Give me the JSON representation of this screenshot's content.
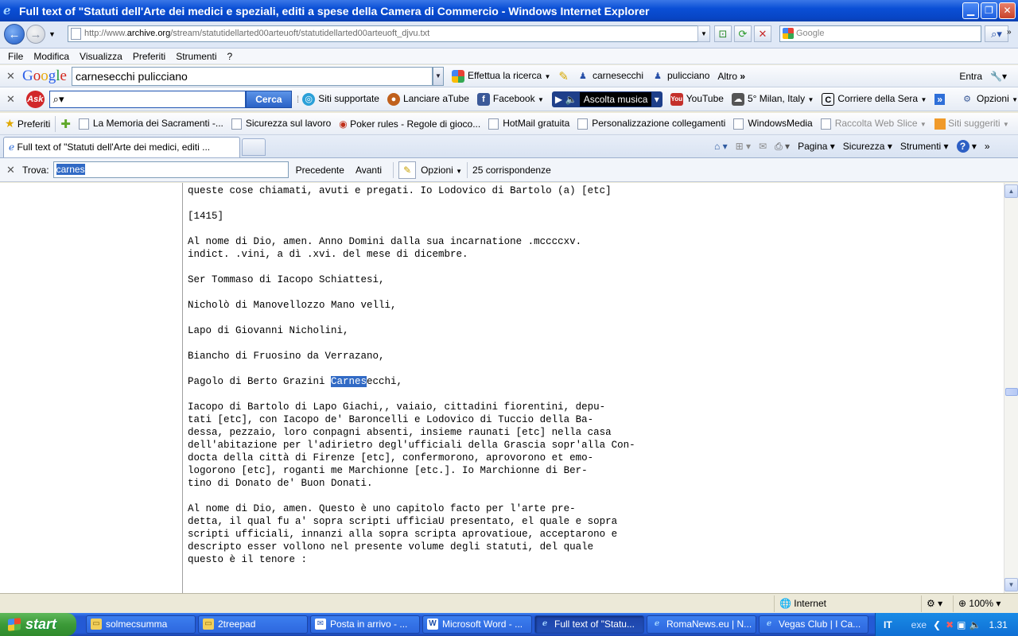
{
  "window": {
    "title": "Full text of \"Statuti dell'Arte dei medici e speziali, editi a spese della Camera di Commercio  - Windows Internet Explorer"
  },
  "address": {
    "url_prefix": "http://www.",
    "url_domain": "archive.org",
    "url_path": "/stream/statutidellarted00arteuoft/statutidellarted00arteuoft_djvu.txt",
    "search_placeholder": "Google"
  },
  "menu": [
    "File",
    "Modifica",
    "Visualizza",
    "Preferiti",
    "Strumenti",
    "?"
  ],
  "google_toolbar": {
    "logo": "Google",
    "query": "carnesecchi pulicciano",
    "search_button": "Effettua la ricerca",
    "term1": "carnesecchi",
    "term2": "pulicciano",
    "more": "Altro",
    "signin": "Entra"
  },
  "ask_toolbar": {
    "logo": "Ask",
    "search_button": "Cerca",
    "siti": "Siti supportate",
    "atube": "Lanciare aTube",
    "facebook": "Facebook",
    "ascolta": "Ascolta musica",
    "youtube": "YouTube",
    "weather": "5° Milan, Italy",
    "corriere": "Corriere della Sera",
    "opzioni": "Opzioni"
  },
  "favorites": {
    "label": "Preferiti",
    "items": [
      "La Memoria dei Sacramenti -...",
      "Sicurezza sul lavoro",
      "Poker rules - Regole di gioco...",
      "HotMail gratuita",
      "Personalizzazione collegamenti",
      "WindowsMedia",
      "Raccolta Web Slice",
      "Siti suggeriti"
    ]
  },
  "tabs": {
    "active_label": "Full text of \"Statuti dell'Arte dei medici, editi ...",
    "pagina": "Pagina",
    "sicurezza": "Sicurezza",
    "strumenti": "Strumenti"
  },
  "findbar": {
    "label": "Trova:",
    "value": "carnes",
    "prev": "Precedente",
    "next": "Avanti",
    "options": "Opzioni",
    "matches": "25 corrispondenze"
  },
  "content": {
    "line_first": "queste cose chiamati, avuti e pregati. Io Lodovico di Bartolo (a) [etc]",
    "year": "[1415]",
    "p1": "Al nome di Dio, amen. Anno Domini dalla sua incarnatione .mccccxv.\nindict. .vini, a dì .xvi. del mese di dicembre.",
    "n1": "Ser Tommaso di Iacopo Schiattesi,",
    "n2": "Nicholò di Manovellozzo Mano velli,",
    "n3": "Lapo di Giovanni Nicholini,",
    "n4": "Biancho di Fruosino da Verrazano,",
    "n5_pre": "Pagolo di Berto Grazini ",
    "n5_hl": "Carnes",
    "n5_post": "ecchi,",
    "p2": "Iacopo di Bartolo di Lapo Giachi,, vaiaio, cittadini fiorentini, depu-\ntati [etc], con Iacopo de' Baroncelli e Lodovico di Tuccio della Ba-\ndessa, pezzaio, loro conpagni absenti, insieme raunati [etc] nella casa\ndell'abitazione per l'adirietro degl'ufficiali della Grascia sopr'alla Con-\ndocta della città di Firenze [etc], confermorono, aprovorono et emo-\nlogorono [etc], roganti me Marchionne [etc.]. Io Marchionne di Ber-\ntino di Donato de' Buon Donati.",
    "p3": "Al nome di Dio, amen. Questo è uno capitolo facto per l'arte pre-\ndetta, il qual fu a' sopra scripti uffìciaU presentato, el quale e sopra\nscripti ufficiali, innanzi alla sopra scripta aprovatioue, acceptarono e\ndescripto esser vollono nel presente volume degli statuti, del quale\nquesto è il tenore :"
  },
  "status": {
    "zone": "Internet",
    "zoom": "100%"
  },
  "taskbar": {
    "start": "start",
    "tasks": [
      "solmecsumma",
      "2treepad",
      "Posta in arrivo - ...",
      "Microsoft Word - ...",
      "Full text of \"Statu...",
      "RomaNews.eu | N...",
      "Vegas Club | I Ca..."
    ],
    "lang": "IT",
    "tray_text": "exe",
    "clock": "1.31"
  }
}
